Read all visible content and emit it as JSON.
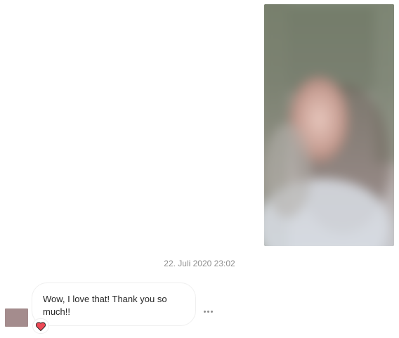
{
  "thread": {
    "timestamp": "22. Juli 2020 23:02"
  },
  "incoming_message": {
    "text": "Wow, I love that! Thank you so much!!",
    "reaction": "heart-icon"
  },
  "media_message": {
    "type": "photo",
    "blurred": true
  },
  "colors": {
    "timestamp_text": "#8e8e8e",
    "bubble_border": "#efefef",
    "message_text": "#262626",
    "reaction_heart": "#ed4956",
    "avatar_placeholder": "#a48c8d"
  }
}
